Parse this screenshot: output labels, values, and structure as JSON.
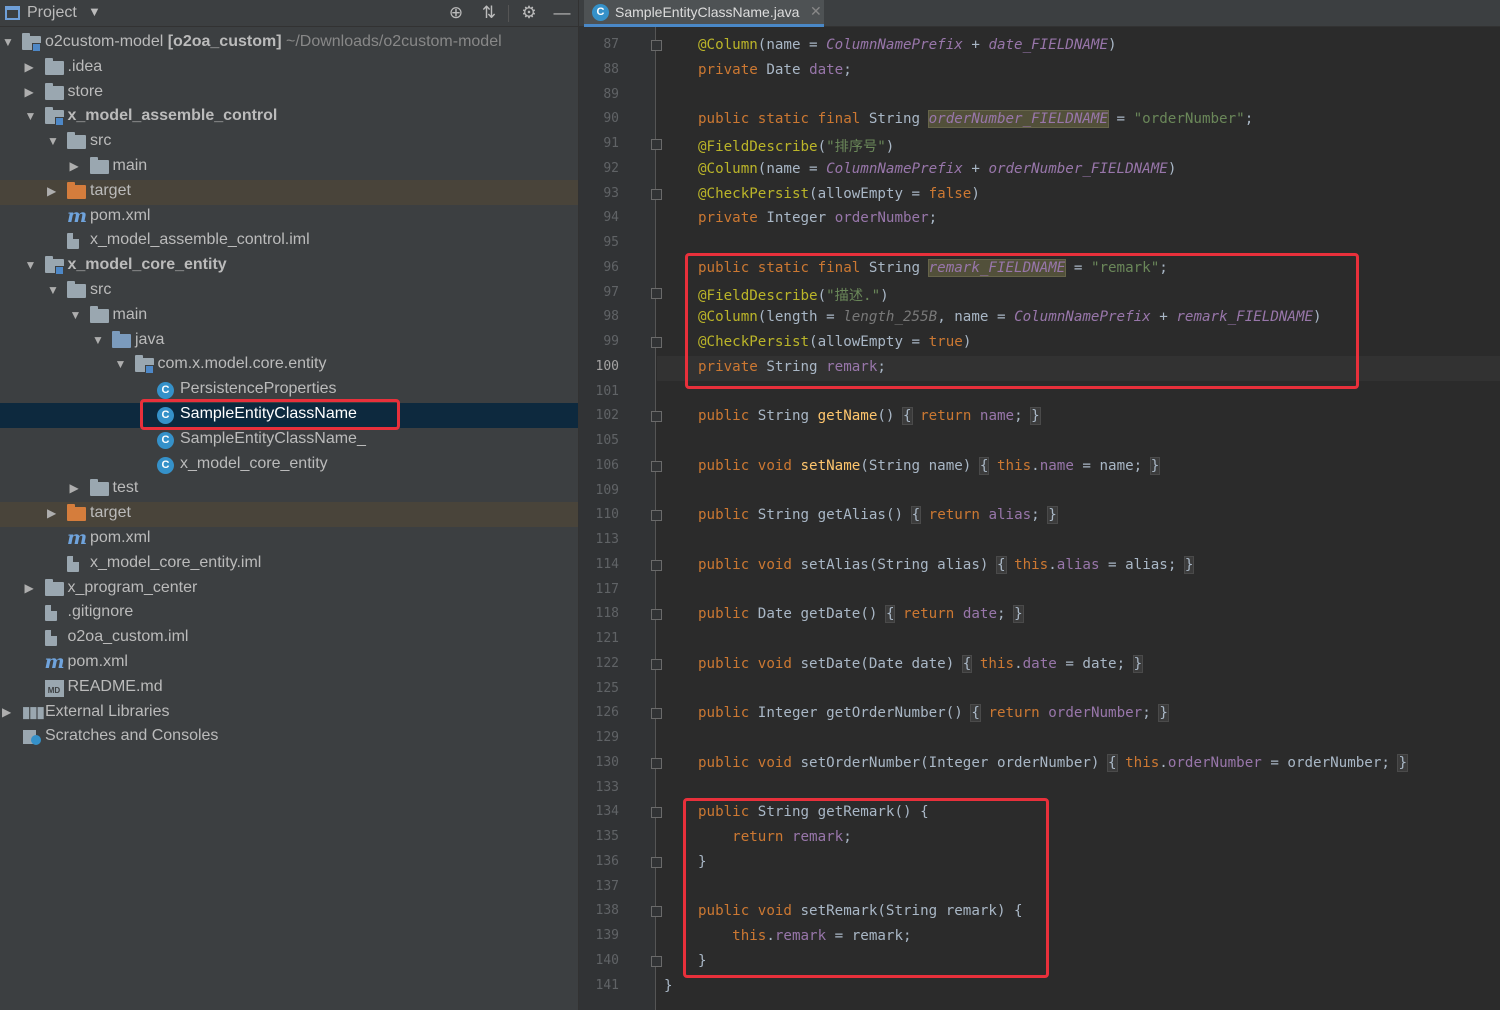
{
  "project_panel": {
    "title": "Project",
    "tree": [
      {
        "label": "o2custom-model",
        "bold_suffix": "[o2oa_custom]",
        "dim": "~/Downloads/o2custom-model",
        "indent": 0,
        "arrow": "down",
        "icon": "module-folder"
      },
      {
        "label": ".idea",
        "indent": 1,
        "arrow": "right",
        "icon": "folder"
      },
      {
        "label": "store",
        "indent": 1,
        "arrow": "right",
        "icon": "folder"
      },
      {
        "label": "x_model_assemble_control",
        "indent": 1,
        "arrow": "down",
        "icon": "module-folder",
        "bold": true
      },
      {
        "label": "src",
        "indent": 2,
        "arrow": "down",
        "icon": "folder"
      },
      {
        "label": "main",
        "indent": 3,
        "arrow": "right",
        "icon": "folder"
      },
      {
        "label": "target",
        "indent": 2,
        "arrow": "right",
        "icon": "folder-orange",
        "highlight": true
      },
      {
        "label": "pom.xml",
        "indent": 2,
        "arrow": "",
        "icon": "maven"
      },
      {
        "label": "x_model_assemble_control.iml",
        "indent": 2,
        "arrow": "",
        "icon": "file"
      },
      {
        "label": "x_model_core_entity",
        "indent": 1,
        "arrow": "down",
        "icon": "module-folder",
        "bold": true
      },
      {
        "label": "src",
        "indent": 2,
        "arrow": "down",
        "icon": "folder"
      },
      {
        "label": "main",
        "indent": 3,
        "arrow": "down",
        "icon": "folder"
      },
      {
        "label": "java",
        "indent": 4,
        "arrow": "down",
        "icon": "folder-blue"
      },
      {
        "label": "com.x.model.core.entity",
        "indent": 5,
        "arrow": "down",
        "icon": "package"
      },
      {
        "label": "PersistenceProperties",
        "indent": 6,
        "arrow": "",
        "icon": "class"
      },
      {
        "label": "SampleEntityClassName",
        "indent": 6,
        "arrow": "",
        "icon": "class",
        "selected": true
      },
      {
        "label": "SampleEntityClassName_",
        "indent": 6,
        "arrow": "",
        "icon": "class"
      },
      {
        "label": "x_model_core_entity",
        "indent": 6,
        "arrow": "",
        "icon": "class"
      },
      {
        "label": "test",
        "indent": 3,
        "arrow": "right",
        "icon": "folder"
      },
      {
        "label": "target",
        "indent": 2,
        "arrow": "right",
        "icon": "folder-orange",
        "highlight": true
      },
      {
        "label": "pom.xml",
        "indent": 2,
        "arrow": "",
        "icon": "maven"
      },
      {
        "label": "x_model_core_entity.iml",
        "indent": 2,
        "arrow": "",
        "icon": "file"
      },
      {
        "label": "x_program_center",
        "indent": 1,
        "arrow": "right",
        "icon": "folder"
      },
      {
        "label": ".gitignore",
        "indent": 1,
        "arrow": "",
        "icon": "file"
      },
      {
        "label": "o2oa_custom.iml",
        "indent": 1,
        "arrow": "",
        "icon": "file"
      },
      {
        "label": "pom.xml",
        "indent": 1,
        "arrow": "",
        "icon": "maven"
      },
      {
        "label": "README.md",
        "indent": 1,
        "arrow": "",
        "icon": "markdown"
      },
      {
        "label": "External Libraries",
        "indent": 0,
        "arrow": "right",
        "icon": "libraries"
      },
      {
        "label": "Scratches and Consoles",
        "indent": 0,
        "arrow": "",
        "icon": "scratches"
      }
    ]
  },
  "editor": {
    "tab_label": "SampleEntityClassName.java",
    "current_line": "100",
    "lines": [
      {
        "n": "87",
        "html": "<span class='an'>@Column</span>(name = <span class='ifld'>ColumnNamePrefix</span> + <span class='ifld'>date_FIELDNAME</span>)"
      },
      {
        "n": "88",
        "html": "<span class='kw'>private </span>Date <span class='fld'>date</span>;"
      },
      {
        "n": "89",
        "html": ""
      },
      {
        "n": "90",
        "html": "<span class='kw'>public static final </span>String <span class='ifld hlbox'>orderNumber_FIELDNAME</span> = <span class='str'>\"orderNumber\"</span>;"
      },
      {
        "n": "91",
        "html": "<span class='an'>@FieldDescribe</span>(<span class='str'>\"排序号\"</span>)"
      },
      {
        "n": "92",
        "html": "<span class='an'>@Column</span>(name = <span class='ifld'>ColumnNamePrefix</span> + <span class='ifld'>orderNumber_FIELDNAME</span>)"
      },
      {
        "n": "93",
        "html": "<span class='an'>@CheckPersist</span>(allowEmpty = <span class='kw'>false</span>)"
      },
      {
        "n": "94",
        "html": "<span class='kw'>private </span>Integer <span class='fld'>orderNumber</span>;"
      },
      {
        "n": "95",
        "html": ""
      },
      {
        "n": "96",
        "html": "<span class='kw'>public static final </span>String <span class='ifld hlbox'>remark_FIELDNAME</span> = <span class='str'>\"remark\"</span>;"
      },
      {
        "n": "97",
        "html": "<span class='an'>@FieldDescribe</span>(<span class='str'>\"描述.\"</span>)"
      },
      {
        "n": "98",
        "html": "<span class='an'>@Column</span>(length = <span class='hint'>length_255B</span>, name = <span class='ifld'>ColumnNamePrefix</span> + <span class='ifld'>remark_FIELDNAME</span>)"
      },
      {
        "n": "99",
        "html": "<span class='an'>@CheckPersist</span>(allowEmpty = <span class='kw'>true</span>)"
      },
      {
        "n": "100",
        "html": "<span class='kw'>private </span>String <span class='fld'>remark</span>;"
      },
      {
        "n": "101",
        "html": ""
      },
      {
        "n": "102",
        "html": "<span class='kw'>public </span>String <span class='mth'>getName</span>() <span class='fbrace'>{</span> <span class='kw'>return </span><span class='fld'>name</span>; <span class='fbrace'>}</span>"
      },
      {
        "n": "105",
        "html": ""
      },
      {
        "n": "106",
        "html": "<span class='kw'>public void </span><span class='mth'>setName</span>(String name) <span class='fbrace'>{</span> <span class='kw'>this</span>.<span class='fld'>name</span> = name; <span class='fbrace'>}</span>"
      },
      {
        "n": "109",
        "html": ""
      },
      {
        "n": "110",
        "html": "<span class='kw'>public </span>String <span class='gmth'>getAlias</span>() <span class='fbrace'>{</span> <span class='kw'>return </span><span class='fld'>alias</span>; <span class='fbrace'>}</span>"
      },
      {
        "n": "113",
        "html": ""
      },
      {
        "n": "114",
        "html": "<span class='kw'>public void </span><span class='gmth'>setAlias</span>(String alias) <span class='fbrace'>{</span> <span class='kw'>this</span>.<span class='fld'>alias</span> = alias; <span class='fbrace'>}</span>"
      },
      {
        "n": "117",
        "html": ""
      },
      {
        "n": "118",
        "html": "<span class='kw'>public </span>Date <span class='gmth'>getDate</span>() <span class='fbrace'>{</span> <span class='kw'>return </span><span class='fld'>date</span>; <span class='fbrace'>}</span>"
      },
      {
        "n": "121",
        "html": ""
      },
      {
        "n": "122",
        "html": "<span class='kw'>public void </span><span class='gmth'>setDate</span>(Date date) <span class='fbrace'>{</span> <span class='kw'>this</span>.<span class='fld'>date</span> = date; <span class='fbrace'>}</span>"
      },
      {
        "n": "125",
        "html": ""
      },
      {
        "n": "126",
        "html": "<span class='kw'>public </span>Integer <span class='gmth'>getOrderNumber</span>() <span class='fbrace'>{</span> <span class='kw'>return </span><span class='fld'>orderNumber</span>; <span class='fbrace'>}</span>"
      },
      {
        "n": "129",
        "html": ""
      },
      {
        "n": "130",
        "html": "<span class='kw'>public void </span><span class='gmth'>setOrderNumber</span>(Integer orderNumber) <span class='fbrace'>{</span> <span class='kw'>this</span>.<span class='fld'>orderNumber</span> = orderNumber; <span class='fbrace'>}</span>"
      },
      {
        "n": "133",
        "html": ""
      },
      {
        "n": "134",
        "html": "<span class='kw'>public </span>String <span class='gmth'>getRemark</span>() {"
      },
      {
        "n": "135",
        "html": "    <span class='kw'>return </span><span class='fld'>remark</span>;"
      },
      {
        "n": "136",
        "html": "}"
      },
      {
        "n": "137",
        "html": ""
      },
      {
        "n": "138",
        "html": "<span class='kw'>public void </span><span class='gmth'>setRemark</span>(String remark) {"
      },
      {
        "n": "139",
        "html": "    <span class='kw'>this</span>.<span class='fld'>remark</span> = remark;"
      },
      {
        "n": "140",
        "html": "}"
      },
      {
        "n": "141",
        "html": "}"
      }
    ]
  },
  "colors": {
    "highlight_box": "#e8303b",
    "selection": "#0d293e",
    "keyword": "#cc7832",
    "annotation": "#bbb529",
    "string": "#6a8759",
    "field": "#9876aa",
    "method": "#ffc66d"
  }
}
